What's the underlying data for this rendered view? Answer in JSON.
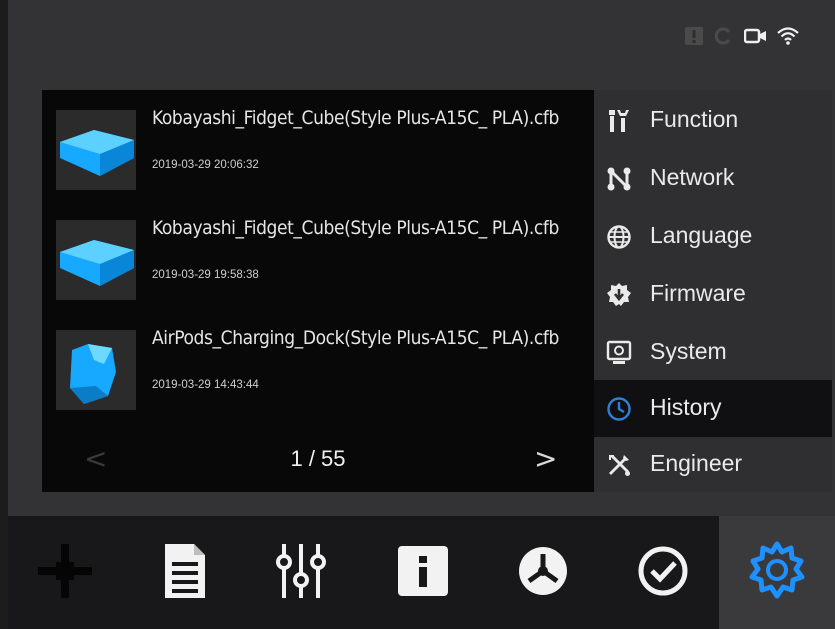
{
  "status_bar": {
    "icons": [
      "warning-icon",
      "refresh-icon",
      "camera-icon",
      "wifi-icon"
    ]
  },
  "files": [
    {
      "name": "Kobayashi_Fidget_Cube(Style Plus-A15C_ PLA).cfb",
      "date": "2019-03-29 20:06:32",
      "thumbnail": "cube-model-thumbnail"
    },
    {
      "name": "Kobayashi_Fidget_Cube(Style Plus-A15C_ PLA).cfb",
      "date": "2019-03-29 19:58:38",
      "thumbnail": "cube-model-thumbnail"
    },
    {
      "name": "AirPods_Charging_Dock(Style Plus-A15C_ PLA).cfb",
      "date": "2019-03-29 14:43:44",
      "thumbnail": "dock-model-thumbnail"
    }
  ],
  "pager": {
    "prev": "<",
    "next": ">",
    "page": "1 / 55"
  },
  "menu": {
    "items": [
      {
        "label": "Function",
        "icon": "tools-icon",
        "active": false
      },
      {
        "label": "Network",
        "icon": "network-icon",
        "active": false
      },
      {
        "label": "Language",
        "icon": "globe-icon",
        "active": false
      },
      {
        "label": "Firmware",
        "icon": "firmware-icon",
        "active": false
      },
      {
        "label": "System",
        "icon": "monitor-icon",
        "active": false
      },
      {
        "label": "History",
        "icon": "clock-icon",
        "active": true
      },
      {
        "label": "Engineer",
        "icon": "wrench-cross-icon",
        "active": false
      }
    ]
  },
  "bottom_nav": {
    "items": [
      "move-axis-icon",
      "document-icon",
      "sliders-icon",
      "info-icon",
      "fan-icon",
      "check-icon",
      "settings-icon"
    ],
    "active": "settings-icon"
  },
  "colors": {
    "accent_blue": "#1e90ff",
    "history_icon": "#2f80d8",
    "background": "#333335",
    "list_background": "#080808"
  }
}
